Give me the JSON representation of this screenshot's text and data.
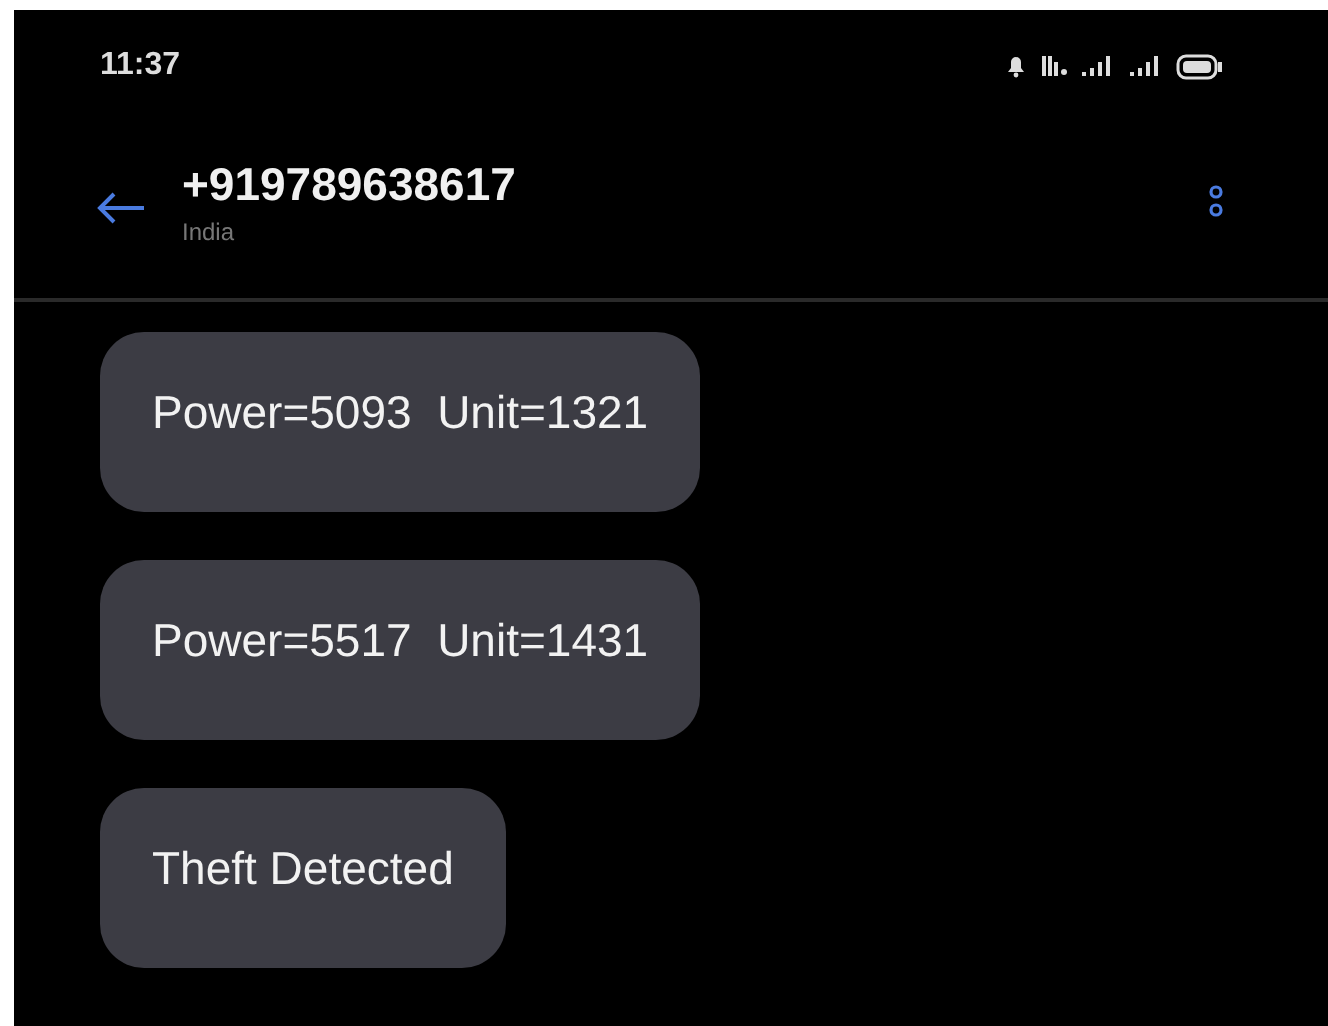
{
  "status_bar": {
    "time": "11:37"
  },
  "header": {
    "contact": "+919789638617",
    "subtitle": "India"
  },
  "messages": [
    {
      "text": "Power=5093  Unit=1321"
    },
    {
      "text": "Power=5517  Unit=1431"
    },
    {
      "text": "Theft Detected"
    }
  ]
}
